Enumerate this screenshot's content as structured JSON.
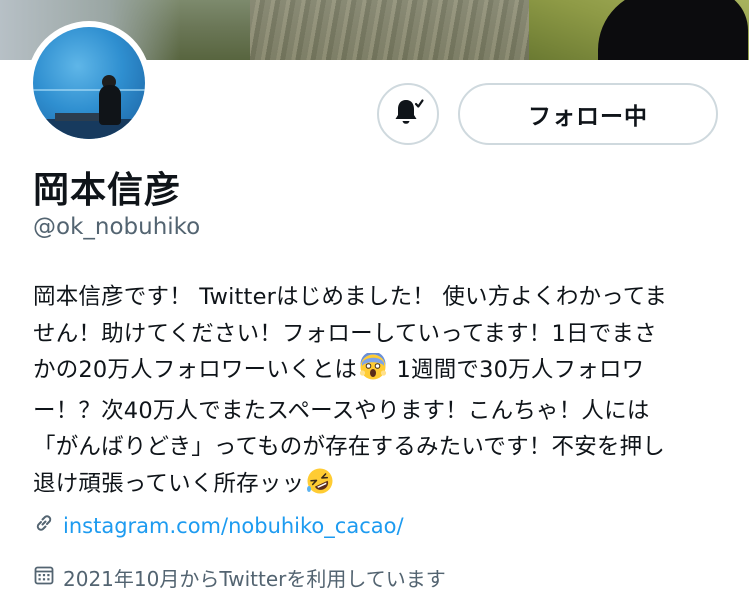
{
  "profile": {
    "display_name": "岡本信彦",
    "handle": "@ok_nobuhiko",
    "follow_button_label": "フォロー中",
    "bio_lines": [
      "岡本信彦です！ Twitterはじめました！ 使い方よくわかってま",
      "せん！助けてください！フォローしていってます！1日でまさ",
      "かの20万人フォロワーいくとは",
      " 1週間で30万人フォロワ",
      "ー！？次40万人でまたスペースやります！こんちゃ！人には",
      "「がんばりどき」ってものが存在するみたいです！不安を押し",
      "退け頑張っていく所存ッッ"
    ],
    "website": "instagram.com/nobuhiko_cacao/",
    "joined": "2021年10月からTwitterを利用しています"
  },
  "icons": {
    "bell": "notification-bell-icon",
    "link": "link-icon",
    "calendar": "calendar-icon",
    "scream_emoji": "face-screaming-in-fear-emoji",
    "rofl_emoji": "rolling-on-floor-laughing-emoji"
  },
  "colors": {
    "text_primary": "#0f1419",
    "text_secondary": "#536471",
    "link": "#1d9bf0",
    "button_border": "#cfd9de"
  }
}
